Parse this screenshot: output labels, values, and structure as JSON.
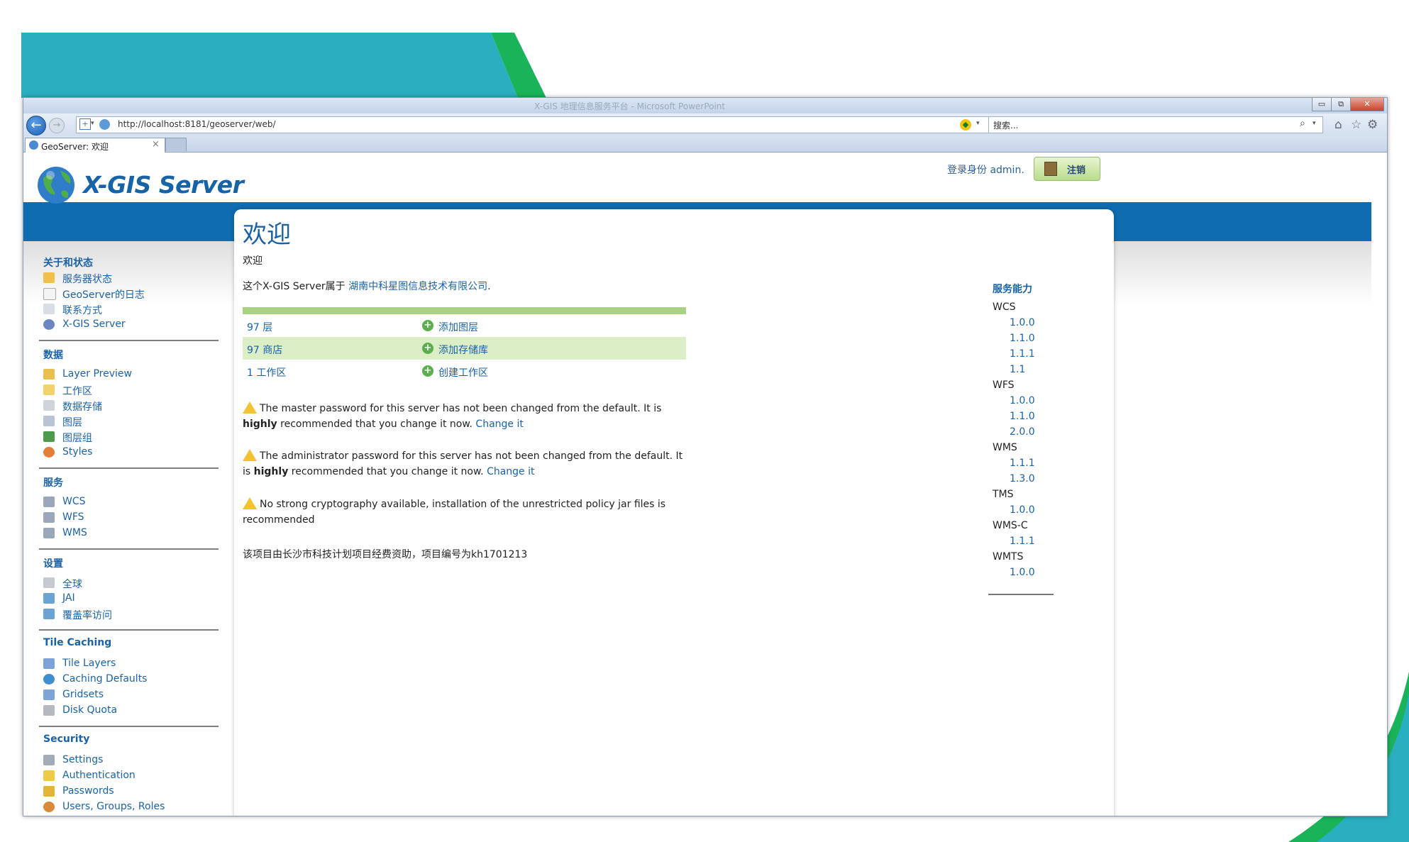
{
  "browser": {
    "window_title": "X-GIS 地理信息服务平台 - Microsoft PowerPoint",
    "minimize": "▭",
    "restore": "⧉",
    "close": "✕",
    "url": "http://localhost:8181/geoserver/web/",
    "search_placeholder": "搜索...",
    "tab_title": "GeoServer: 欢迎",
    "tab_close": "×"
  },
  "header": {
    "logo_text": "X-GIS Server",
    "login_status": "登录身份 admin.",
    "logout_label": "注销"
  },
  "sidebar": {
    "sections": [
      {
        "title": "关于和状态",
        "items": [
          {
            "label": "服务器状态",
            "icon": "server-status-icon"
          },
          {
            "label": "GeoServer的日志",
            "icon": "log-icon"
          },
          {
            "label": "联系方式",
            "icon": "contact-icon"
          },
          {
            "label": "X-GIS Server",
            "icon": "about-icon"
          }
        ]
      },
      {
        "title": "数据",
        "items": [
          {
            "label": "Layer Preview",
            "icon": "layer-preview-icon"
          },
          {
            "label": "工作区",
            "icon": "workspace-icon"
          },
          {
            "label": "数据存储",
            "icon": "datastore-icon"
          },
          {
            "label": "图层",
            "icon": "layer-icon"
          },
          {
            "label": "图层组",
            "icon": "layer-group-icon"
          },
          {
            "label": "Styles",
            "icon": "styles-icon"
          }
        ]
      },
      {
        "title": "服务",
        "items": [
          {
            "label": "WCS",
            "icon": "wcs-icon"
          },
          {
            "label": "WFS",
            "icon": "wfs-icon"
          },
          {
            "label": "WMS",
            "icon": "wms-icon"
          }
        ]
      },
      {
        "title": "设置",
        "items": [
          {
            "label": "全球",
            "icon": "global-settings-icon"
          },
          {
            "label": "JAI",
            "icon": "jai-icon"
          },
          {
            "label": "覆盖率访问",
            "icon": "coverage-access-icon"
          }
        ]
      },
      {
        "title": "Tile Caching",
        "items": [
          {
            "label": "Tile Layers",
            "icon": "tile-layers-icon"
          },
          {
            "label": "Caching Defaults",
            "icon": "caching-defaults-icon"
          },
          {
            "label": "Gridsets",
            "icon": "gridsets-icon"
          },
          {
            "label": "Disk Quota",
            "icon": "disk-quota-icon"
          }
        ]
      },
      {
        "title": "Security",
        "items": [
          {
            "label": "Settings",
            "icon": "settings-icon"
          },
          {
            "label": "Authentication",
            "icon": "authentication-icon"
          },
          {
            "label": "Passwords",
            "icon": "passwords-icon"
          },
          {
            "label": "Users, Groups, Roles",
            "icon": "users-groups-roles-icon"
          }
        ]
      }
    ]
  },
  "main": {
    "title": "欢迎",
    "subtitle": "欢迎",
    "owner_prefix": "这个X-GIS Server属于 ",
    "owner_link": "湖南中科星图信息技术有限公司",
    "owner_suffix": ".",
    "stats": [
      {
        "count": "97 层",
        "action": "添加图层"
      },
      {
        "count": "97 商店",
        "action": "添加存储库"
      },
      {
        "count": "1 工作区",
        "action": "创建工作区"
      }
    ],
    "warnings": [
      {
        "pre": "The master password for this server has not been changed from the default. It is ",
        "bold": "highly",
        "post": " recommended that you change it now. ",
        "link": "Change it"
      },
      {
        "pre": "The administrator password for this server has not been changed from the default. It is ",
        "bold": "highly",
        "post": " recommended that you change it now. ",
        "link": "Change it"
      },
      {
        "pre": "No strong cryptography available, installation of the unrestricted policy jar files is recommended",
        "bold": "",
        "post": "",
        "link": ""
      }
    ],
    "funding": "该项目由长沙市科技计划项目经费资助，项目编号为kh1701213"
  },
  "capabilities": {
    "title": "服务能力",
    "services": [
      {
        "name": "WCS",
        "versions": [
          "1.0.0",
          "1.1.0",
          "1.1.1",
          "1.1"
        ]
      },
      {
        "name": "WFS",
        "versions": [
          "1.0.0",
          "1.1.0",
          "2.0.0"
        ]
      },
      {
        "name": "WMS",
        "versions": [
          "1.1.1",
          "1.3.0"
        ]
      },
      {
        "name": "TMS",
        "versions": [
          "1.0.0"
        ]
      },
      {
        "name": "WMS-C",
        "versions": [
          "1.1.1"
        ]
      },
      {
        "name": "WMTS",
        "versions": [
          "1.0.0"
        ]
      }
    ]
  },
  "colors": {
    "link": "#1a62a8",
    "band": "#0f6cb0",
    "stats_alt_row": "#dbeec6",
    "deco_teal": "#2aafc0",
    "deco_green": "#1bb35a"
  }
}
